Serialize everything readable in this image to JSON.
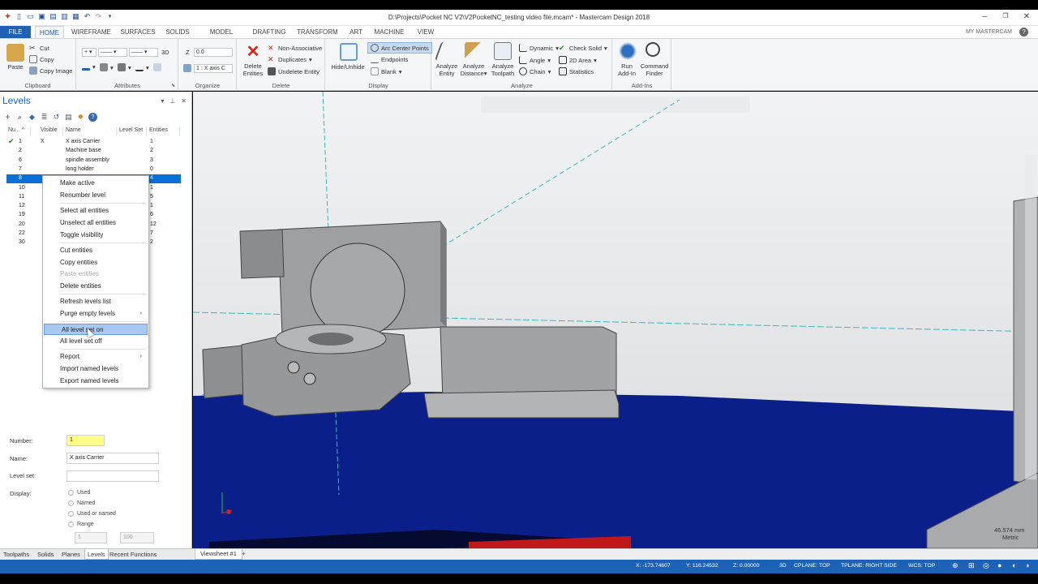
{
  "window": {
    "title": "D:\\Projects\\Pocket NC V2\\V2PocketNC_testing video file.mcam* - Mastercam Design 2018",
    "minimize": "–",
    "restore": "❐",
    "close": "✕"
  },
  "tabs": {
    "file": "FILE",
    "home": "HOME",
    "others": [
      "WIREFRAME",
      "SURFACES",
      "SOLIDS",
      "MODEL PREP",
      "DRAFTING",
      "TRANSFORM",
      "ART",
      "MACHINE",
      "VIEW"
    ],
    "my_mastercam": "MY MASTERCAM",
    "help": "?"
  },
  "ribbon": {
    "clipboard": {
      "label": "Clipboard",
      "paste": "Paste",
      "cut": "Cut",
      "copy": "Copy",
      "copy_image": "Copy Image"
    },
    "attributes": {
      "label": "Attributes",
      "mode_3d": "3D"
    },
    "organize": {
      "label": "Organize",
      "z_label": "Z",
      "z_value": "0.0",
      "level_value": "1 : X axis C"
    },
    "delete": {
      "label": "Delete",
      "delete_entities": [
        "Delete",
        "Entities"
      ],
      "non_associative": "Non-Associative",
      "duplicates": "Duplicates",
      "undelete_entity": "Undelete Entity"
    },
    "display": {
      "label": "Display",
      "hide_unhide": "Hide/Unhide",
      "arc_center_points": "Arc Center Points",
      "endpoints": "Endpoints",
      "blank": "Blank"
    },
    "analyze": {
      "label": "Analyze",
      "analyze_entity": [
        "Analyze",
        "Entity"
      ],
      "analyze_distance": [
        "Analyze",
        "Distance"
      ],
      "analyze_toolpath": [
        "Analyze",
        "Toolpath"
      ],
      "dynamic": "Dynamic",
      "angle": "Angle",
      "chain": "Chain",
      "check_solid": "Check Solid",
      "area_2d": "2D Area",
      "statistics": "Statistics"
    },
    "addins": {
      "label": "Add-Ins",
      "run_addin": [
        "Run",
        "Add-In"
      ],
      "command_finder": [
        "Command",
        "Finder"
      ]
    }
  },
  "levels_panel": {
    "title": "Levels",
    "columns": [
      "Nu...",
      "Visible",
      "Name",
      "Level Set",
      "Entities"
    ],
    "rows": [
      {
        "number": "1",
        "visible": "X",
        "name": "X axis Carrier",
        "entities": "1",
        "active": true
      },
      {
        "number": "2",
        "visible": "",
        "name": "Machine base",
        "entities": "2"
      },
      {
        "number": "6",
        "visible": "",
        "name": "spindle assembly",
        "entities": "3"
      },
      {
        "number": "7",
        "visible": "",
        "name": "long holder",
        "entities": "0"
      },
      {
        "number": "8",
        "visible": "",
        "name": "",
        "entities": "4",
        "selected": true
      },
      {
        "number": "10",
        "visible": "",
        "name": "",
        "entities": "1"
      },
      {
        "number": "11",
        "visible": "",
        "name": "",
        "entities": "5"
      },
      {
        "number": "12",
        "visible": "",
        "name": "",
        "entities": "1"
      },
      {
        "number": "19",
        "visible": "",
        "name": "",
        "entities": "6"
      },
      {
        "number": "20",
        "visible": "",
        "name": "",
        "entities": "12"
      },
      {
        "number": "22",
        "visible": "",
        "name": "",
        "entities": "7"
      },
      {
        "number": "30",
        "visible": "",
        "name": "",
        "entities": "2"
      }
    ]
  },
  "context_menu": {
    "make_active": "Make active",
    "renumber_level": "Renumber level",
    "select_all_entities": "Select all entities",
    "unselect_all_entities": "Unselect all entities",
    "toggle_visibility": "Toggle visibility",
    "cut_entities": "Cut entities",
    "copy_entities": "Copy entities",
    "paste_entities": "Paste entities",
    "delete_entities": "Delete entities",
    "refresh_levels_list": "Refresh levels list",
    "purge_empty_levels": "Purge empty levels",
    "all_level_set_on": "All level set on",
    "all_level_set_off": "All level set off",
    "report": "Report",
    "import_named_levels": "Import named levels",
    "export_named_levels": "Export named levels"
  },
  "properties": {
    "number_label": "Number:",
    "number_value": "1",
    "name_label": "Name:",
    "name_value": "X axis Carrier",
    "level_set_label": "Level set:",
    "level_set_value": "",
    "display_label": "Display:",
    "display_options": [
      "Used",
      "Named",
      "Used or named",
      "Range"
    ],
    "range_from": "1",
    "range_to": "100"
  },
  "bottom_tabs": [
    "Toolpaths",
    "Solids",
    "Planes",
    "Levels",
    "Recent Functions"
  ],
  "viewsheet": {
    "tab": "Viewsheet #1",
    "add": "+"
  },
  "viewport": {
    "scale_value": "46.574 mm",
    "scale_unit": "Metric"
  },
  "status": {
    "x": "X:  -173.74607",
    "y": "Y:  116.24532",
    "z": "Z:  0.00000",
    "mode": "3D",
    "cplane": "CPLANE: TOP",
    "tplane": "TPLANE: RIGHT SIDE",
    "wcs": "WCS: TOP"
  },
  "colors": {
    "accent": "#1e62b8",
    "selection": "#0a6fd6",
    "viewport_bg": "#e4e6e8",
    "floor": "#0b1f8a"
  }
}
